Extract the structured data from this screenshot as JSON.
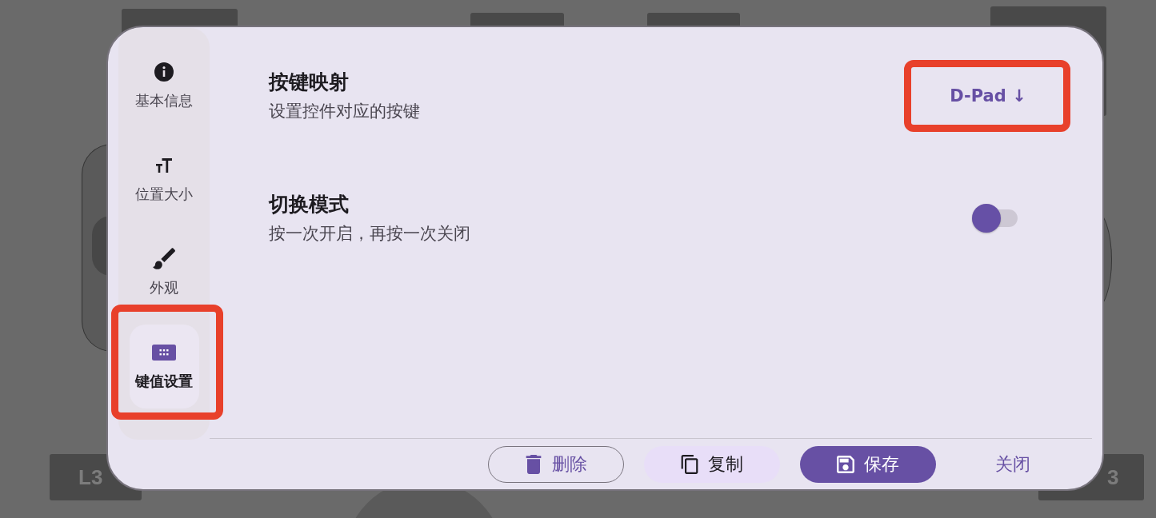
{
  "background": {
    "keys": [
      {
        "label": "L3"
      },
      {
        "label": "3"
      }
    ]
  },
  "sidebar": {
    "items": [
      {
        "kind": "info",
        "label": "基本信息",
        "selected": false,
        "highlighted": false
      },
      {
        "kind": "size",
        "label": "位置大小",
        "selected": false,
        "highlighted": false
      },
      {
        "kind": "appearance",
        "label": "外观",
        "selected": false,
        "highlighted": false
      },
      {
        "kind": "keys",
        "label": "键值设置",
        "selected": true,
        "highlighted": true
      }
    ]
  },
  "settings": [
    {
      "kind": "button",
      "title": "按键映射",
      "subtitle": "设置控件对应的按键",
      "value": "D-Pad ↓",
      "highlighted": true
    },
    {
      "kind": "switch",
      "title": "切换模式",
      "subtitle": "按一次开启，再按一次关闭",
      "on": false,
      "highlighted": false
    }
  ],
  "actions": [
    {
      "kind": "delete",
      "label": "删除"
    },
    {
      "kind": "copy",
      "label": "复制"
    },
    {
      "kind": "save",
      "label": "保存"
    },
    {
      "kind": "close",
      "label": "关闭"
    }
  ]
}
